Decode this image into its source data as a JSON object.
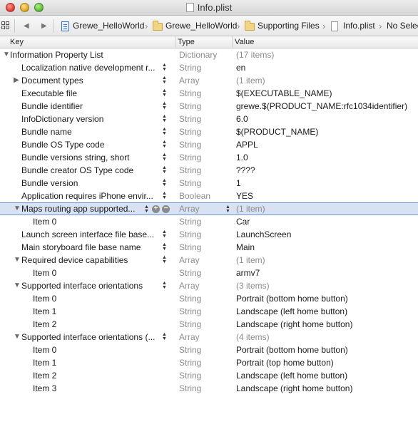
{
  "window": {
    "title": "Info.plist"
  },
  "jumpbar": {
    "project": "Grewe_HelloWorld",
    "group": "Grewe_HelloWorld",
    "folder": "Supporting Files",
    "file": "Info.plist",
    "selection": "No Selec"
  },
  "columns": {
    "key": "Key",
    "type": "Type",
    "value": "Value"
  },
  "rows": [
    {
      "key": "Information Property List",
      "type": "Dictionary",
      "value": "(17 items)",
      "level": 0,
      "disclosure": "open",
      "stepper": false,
      "dim_value": true
    },
    {
      "key": "Localization native development r...",
      "type": "String",
      "value": "en",
      "level": 1,
      "disclosure": "none",
      "stepper": true,
      "dim_value": false
    },
    {
      "key": "Document types",
      "type": "Array",
      "value": "(1 item)",
      "level": 1,
      "disclosure": "closed",
      "stepper": true,
      "dim_value": true
    },
    {
      "key": "Executable file",
      "type": "String",
      "value": "$(EXECUTABLE_NAME)",
      "level": 1,
      "disclosure": "none",
      "stepper": true,
      "dim_value": false
    },
    {
      "key": "Bundle identifier",
      "type": "String",
      "value": "grewe.$(PRODUCT_NAME:rfc1034identifier)",
      "level": 1,
      "disclosure": "none",
      "stepper": true,
      "dim_value": false
    },
    {
      "key": "InfoDictionary version",
      "type": "String",
      "value": "6.0",
      "level": 1,
      "disclosure": "none",
      "stepper": true,
      "dim_value": false
    },
    {
      "key": "Bundle name",
      "type": "String",
      "value": "$(PRODUCT_NAME)",
      "level": 1,
      "disclosure": "none",
      "stepper": true,
      "dim_value": false
    },
    {
      "key": "Bundle OS Type code",
      "type": "String",
      "value": "APPL",
      "level": 1,
      "disclosure": "none",
      "stepper": true,
      "dim_value": false
    },
    {
      "key": "Bundle versions string, short",
      "type": "String",
      "value": "1.0",
      "level": 1,
      "disclosure": "none",
      "stepper": true,
      "dim_value": false
    },
    {
      "key": "Bundle creator OS Type code",
      "type": "String",
      "value": "????",
      "level": 1,
      "disclosure": "none",
      "stepper": true,
      "dim_value": false
    },
    {
      "key": "Bundle version",
      "type": "String",
      "value": "1",
      "level": 1,
      "disclosure": "none",
      "stepper": true,
      "dim_value": false
    },
    {
      "key": "Application requires iPhone envir...",
      "type": "Boolean",
      "value": "YES",
      "level": 1,
      "disclosure": "none",
      "stepper": true,
      "dim_value": false
    },
    {
      "key": "Maps routing app supported...",
      "type": "Array",
      "value": "(1 item)",
      "level": 1,
      "disclosure": "open",
      "stepper": true,
      "dim_value": true,
      "selected": true
    },
    {
      "key": "Item 0",
      "type": "String",
      "value": "Car",
      "level": 2,
      "disclosure": "none",
      "stepper": false,
      "dim_value": false
    },
    {
      "key": "Launch screen interface file base...",
      "type": "String",
      "value": "LaunchScreen",
      "level": 1,
      "disclosure": "none",
      "stepper": true,
      "dim_value": false
    },
    {
      "key": "Main storyboard file base name",
      "type": "String",
      "value": "Main",
      "level": 1,
      "disclosure": "none",
      "stepper": true,
      "dim_value": false
    },
    {
      "key": "Required device capabilities",
      "type": "Array",
      "value": "(1 item)",
      "level": 1,
      "disclosure": "open",
      "stepper": true,
      "dim_value": true
    },
    {
      "key": "Item 0",
      "type": "String",
      "value": "armv7",
      "level": 2,
      "disclosure": "none",
      "stepper": false,
      "dim_value": false
    },
    {
      "key": "Supported interface orientations",
      "type": "Array",
      "value": "(3 items)",
      "level": 1,
      "disclosure": "open",
      "stepper": true,
      "dim_value": true
    },
    {
      "key": "Item 0",
      "type": "String",
      "value": "Portrait (bottom home button)",
      "level": 2,
      "disclosure": "none",
      "stepper": false,
      "dim_value": false
    },
    {
      "key": "Item 1",
      "type": "String",
      "value": "Landscape (left home button)",
      "level": 2,
      "disclosure": "none",
      "stepper": false,
      "dim_value": false
    },
    {
      "key": "Item 2",
      "type": "String",
      "value": "Landscape (right home button)",
      "level": 2,
      "disclosure": "none",
      "stepper": false,
      "dim_value": false
    },
    {
      "key": "Supported interface orientations (...",
      "type": "Array",
      "value": "(4 items)",
      "level": 1,
      "disclosure": "open",
      "stepper": true,
      "dim_value": true
    },
    {
      "key": "Item 0",
      "type": "String",
      "value": "Portrait (bottom home button)",
      "level": 2,
      "disclosure": "none",
      "stepper": false,
      "dim_value": false
    },
    {
      "key": "Item 1",
      "type": "String",
      "value": "Portrait (top home button)",
      "level": 2,
      "disclosure": "none",
      "stepper": false,
      "dim_value": false
    },
    {
      "key": "Item 2",
      "type": "String",
      "value": "Landscape (left home button)",
      "level": 2,
      "disclosure": "none",
      "stepper": false,
      "dim_value": false
    },
    {
      "key": "Item 3",
      "type": "String",
      "value": "Landscape (right home button)",
      "level": 2,
      "disclosure": "none",
      "stepper": false,
      "dim_value": false
    }
  ],
  "icons": {
    "grid": "grid-icon",
    "back": "back-arrow-icon",
    "forward": "forward-arrow-icon",
    "project": "xcode-project-icon",
    "folder": "folder-icon",
    "file": "plist-file-icon",
    "add": "add-circle-icon",
    "remove": "remove-circle-icon"
  },
  "colors": {
    "selection": "#d8e2f2",
    "selection_border": "#6f96d1",
    "secondary_text": "#8c8c8c"
  }
}
